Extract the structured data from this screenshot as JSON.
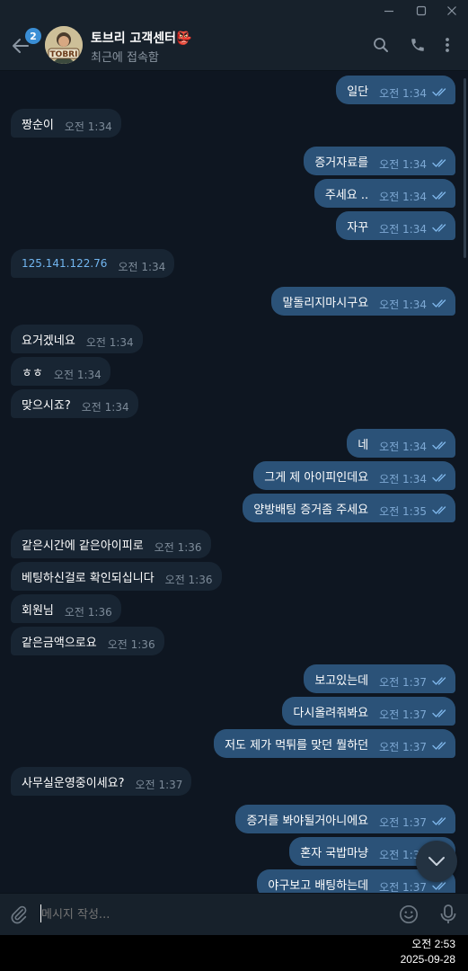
{
  "header": {
    "back_badge": "2",
    "avatar_text": "TOBRI",
    "title": "토브리 고객센터",
    "title_emoji": "👺",
    "status": "최근에 접속함"
  },
  "messages": [
    {
      "dir": "out",
      "text": "일단",
      "time": "오전 1:34"
    },
    {
      "dir": "in",
      "text": "짱순이",
      "time": "오전 1:34"
    },
    {
      "dir": "out",
      "text": "증거자료를",
      "time": "오전 1:34"
    },
    {
      "dir": "out",
      "text": "주세요 ..",
      "time": "오전 1:34"
    },
    {
      "dir": "out",
      "text": "자꾸",
      "time": "오전 1:34"
    },
    {
      "dir": "in",
      "text": "125.141.122.76",
      "time": "오전 1:34",
      "link": true
    },
    {
      "dir": "out",
      "text": "말돌리지마시구요",
      "time": "오전 1:34"
    },
    {
      "dir": "in",
      "text": "요거겠네요",
      "time": "오전 1:34"
    },
    {
      "dir": "in",
      "text": "ㅎㅎ",
      "time": "오전 1:34"
    },
    {
      "dir": "in",
      "text": "맞으시죠?",
      "time": "오전 1:34"
    },
    {
      "dir": "out",
      "text": "네",
      "time": "오전 1:34"
    },
    {
      "dir": "out",
      "text": "그게 제 아이피인데요",
      "time": "오전 1:34"
    },
    {
      "dir": "out",
      "text": "양방배팅 증거좀 주세요",
      "time": "오전 1:35"
    },
    {
      "dir": "in",
      "text": "같은시간에 같은아이피로",
      "time": "오전 1:36"
    },
    {
      "dir": "in",
      "text": "베팅하신걸로 확인되십니다",
      "time": "오전 1:36"
    },
    {
      "dir": "in",
      "text": "회원님",
      "time": "오전 1:36"
    },
    {
      "dir": "in",
      "text": "같은금액으로요",
      "time": "오전 1:36"
    },
    {
      "dir": "out",
      "text": "보고있는데",
      "time": "오전 1:37"
    },
    {
      "dir": "out",
      "text": "다시올려줘봐요",
      "time": "오전 1:37"
    },
    {
      "dir": "out",
      "text": "저도 제가 먹튀를 맞던 뭘하던",
      "time": "오전 1:37"
    },
    {
      "dir": "in",
      "text": "사무실운영중이세요?",
      "time": "오전 1:37"
    },
    {
      "dir": "out",
      "text": "증거를 봐야될거아니에요",
      "time": "오전 1:37"
    },
    {
      "dir": "out",
      "text": "혼자 국밥마냥",
      "time": "오전 1:37"
    },
    {
      "dir": "out",
      "text": "야구보고 배팅하는데",
      "time": "오전 1:37"
    }
  ],
  "composer": {
    "placeholder": "메시지 작성..."
  },
  "taskbar": {
    "time": "오전 2:53",
    "date": "2025-09-28"
  },
  "colors": {
    "background": "#0e1621",
    "panel": "#17212b",
    "incoming": "#182533",
    "outgoing": "#2b5278",
    "accent": "#3a8ed5"
  }
}
